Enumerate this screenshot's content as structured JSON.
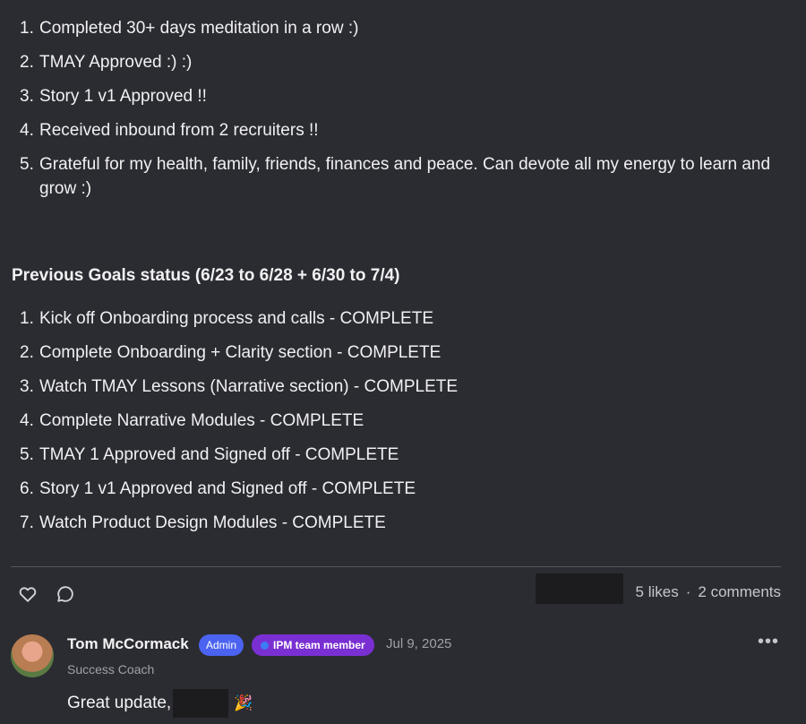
{
  "wins": [
    {
      "num": "1.",
      "text": "Completed 30+ days meditation in a row :)"
    },
    {
      "num": "2.",
      "text": "TMAY Approved :) :)"
    },
    {
      "num": "3.",
      "text": "Story 1 v1 Approved !!"
    },
    {
      "num": "4.",
      "text": "Received inbound from 2 recruiters !!"
    },
    {
      "num": "5.",
      "text": "Grateful for my health, family, friends, finances and peace. Can devote all my energy to learn and grow :)"
    }
  ],
  "goals_heading": "Previous Goals status (6/23 to 6/28 + 6/30 to 7/4)",
  "goals": [
    {
      "num": "1.",
      "text": "Kick off Onboarding process and calls - COMPLETE"
    },
    {
      "num": "2.",
      "text": "Complete Onboarding + Clarity section - COMPLETE"
    },
    {
      "num": "3.",
      "text": "Watch TMAY Lessons (Narrative section) - COMPLETE"
    },
    {
      "num": "4.",
      "text": "Complete Narrative Modules - COMPLETE"
    },
    {
      "num": "5.",
      "text": "TMAY 1 Approved and Signed off - COMPLETE"
    },
    {
      "num": "6.",
      "text": "Story 1 v1 Approved and Signed off - COMPLETE"
    },
    {
      "num": "7.",
      "text": "Watch Product Design Modules - COMPLETE"
    }
  ],
  "post_actions": {
    "like_icon": "heart-icon",
    "comment_icon": "comment-bubble-icon",
    "likes": "5 likes",
    "separator": "·",
    "comments": "2 comments"
  },
  "comment": {
    "author": "Tom McCormack",
    "badge_admin": "Admin",
    "badge_team": "IPM team member",
    "date": "Jul 9, 2025",
    "role": "Success Coach",
    "text": "Great update,",
    "emoji": "🎉",
    "more": "•••"
  },
  "colors": {
    "background": "#2b2c31",
    "admin_badge": "#4b63f0",
    "team_badge": "#7a2fd3"
  }
}
